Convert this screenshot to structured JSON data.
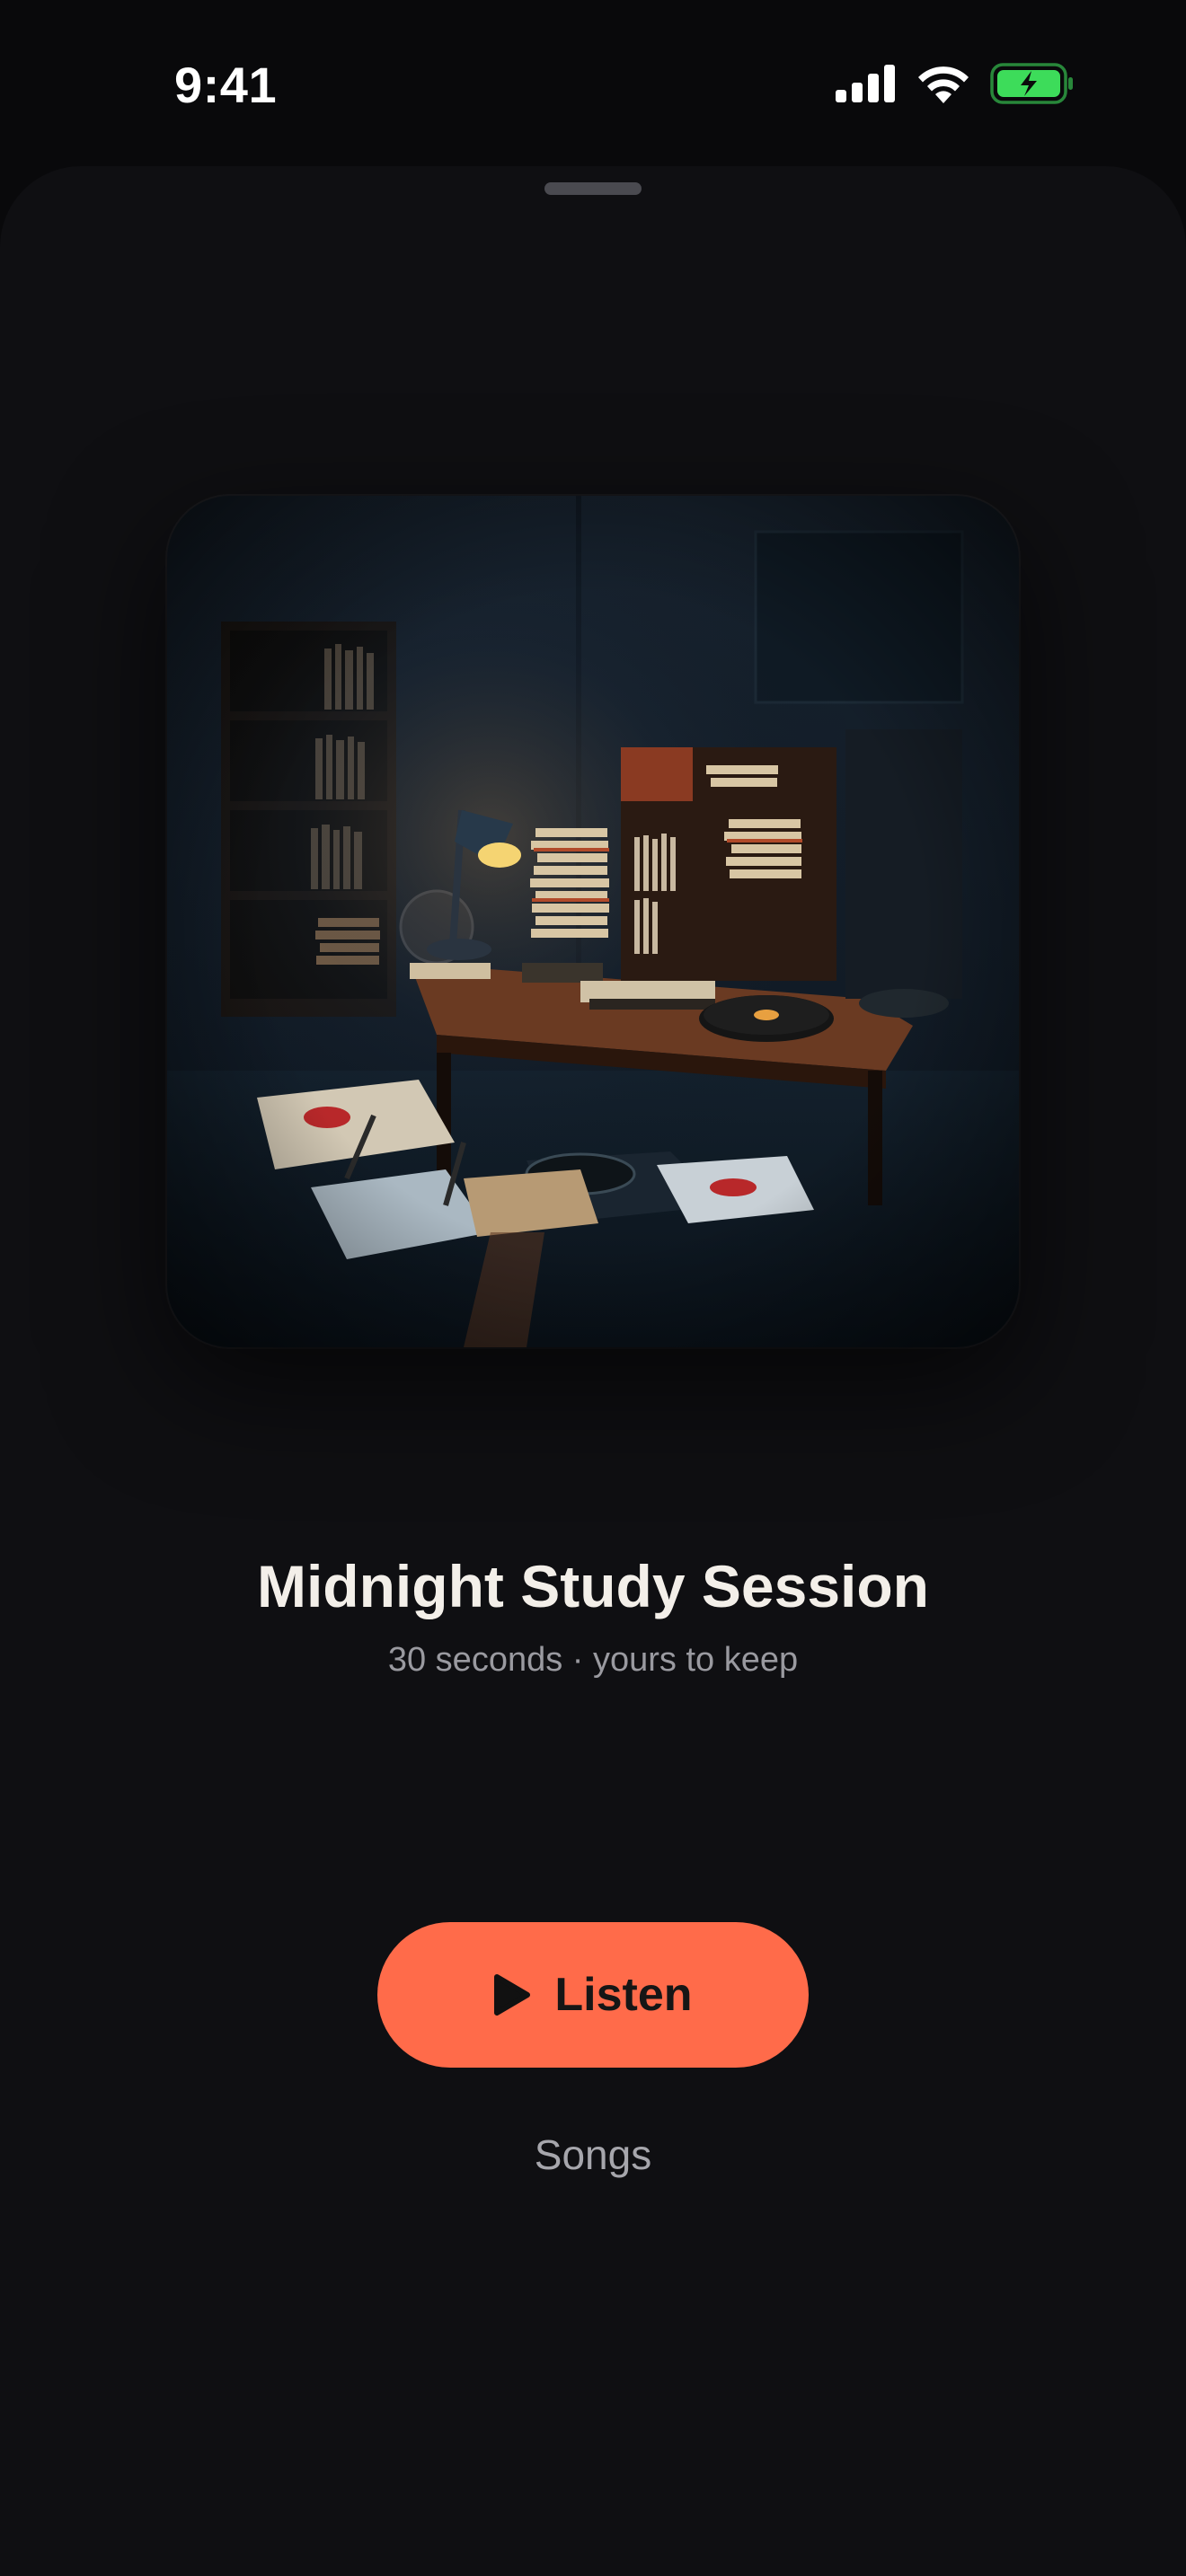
{
  "status_bar": {
    "time": "9:41",
    "icons": [
      "cellular-signal-icon",
      "wifi-icon",
      "battery-charging-icon"
    ],
    "battery_color": "#3ddc5a"
  },
  "sheet": {
    "artwork": {
      "description_icon": "album-artwork"
    },
    "title": "Midnight Study Session",
    "subtitle": "30 seconds · yours to keep",
    "listen_button": {
      "label": "Listen",
      "icon": "play-icon",
      "color": "#ff6b4a"
    },
    "songs_link": "Songs"
  }
}
